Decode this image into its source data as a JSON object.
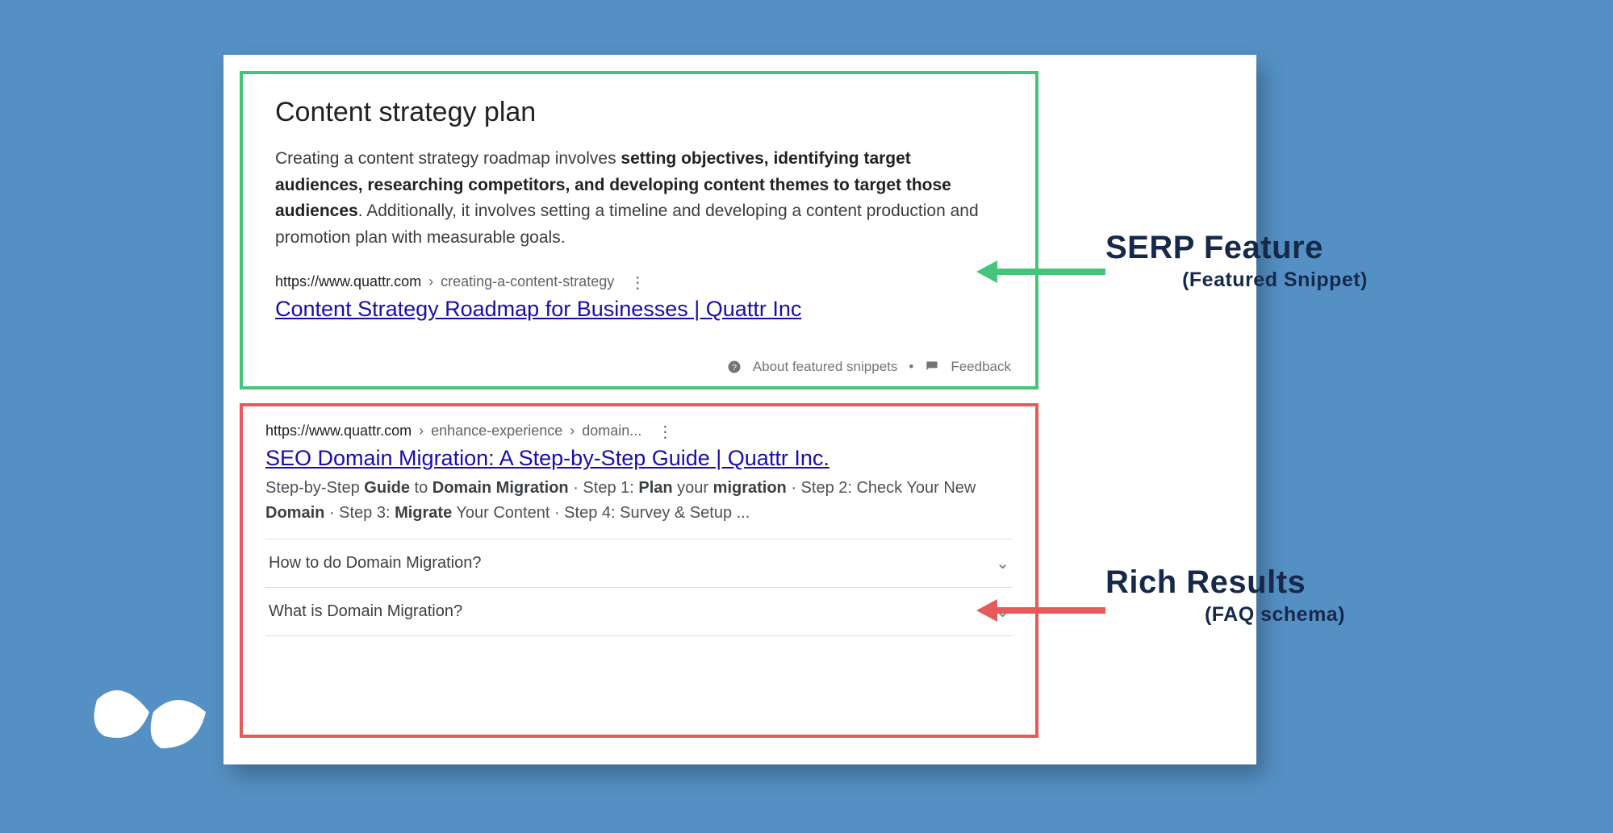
{
  "colors": {
    "background": "#5490c4",
    "snippetBorder": "#45c57a",
    "richBorder": "#e65a5a",
    "link": "#1a0dab",
    "annotText": "#17294a"
  },
  "featuredSnippet": {
    "title": "Content strategy plan",
    "body_leadin": "Creating a content strategy roadmap involves ",
    "body_bold": "setting objectives, identifying target audiences, researching competitors, and developing content themes to target those audiences",
    "body_trail": ". Additionally, it involves setting a timeline and developing a content production and promotion plan with measurable goals.",
    "breadcrumb_domain": "https://www.quattr.com",
    "breadcrumb_path": "creating-a-content-strategy",
    "link_title": "Content Strategy Roadmap for Businesses | Quattr Inc",
    "footer_about": "About featured snippets",
    "footer_feedback": "Feedback"
  },
  "richResult": {
    "breadcrumb_domain": "https://www.quattr.com",
    "breadcrumb_path1": "enhance-experience",
    "breadcrumb_path2": "domain...",
    "link_title": "SEO Domain Migration: A Step-by-Step Guide | Quattr Inc.",
    "desc_parts": {
      "p1": "Step-by-Step ",
      "b1": "Guide",
      "p2": " to ",
      "b2": "Domain Migration",
      "p3": " · Step 1: ",
      "b3": "Plan",
      "p4": " your ",
      "b4": "migration",
      "p5": " · Step 2: Check Your New ",
      "b5": "Domain",
      "p6": " · Step 3: ",
      "b6": "Migrate",
      "p7": " Your Content · Step 4: Survey & Setup ..."
    },
    "faqs": [
      "How to do Domain Migration?",
      "What is Domain Migration?"
    ]
  },
  "annotations": {
    "serp_main": "SERP Feature",
    "serp_sub": "(Featured Snippet)",
    "rich_main": "Rich Results",
    "rich_sub": "(FAQ schema)"
  }
}
